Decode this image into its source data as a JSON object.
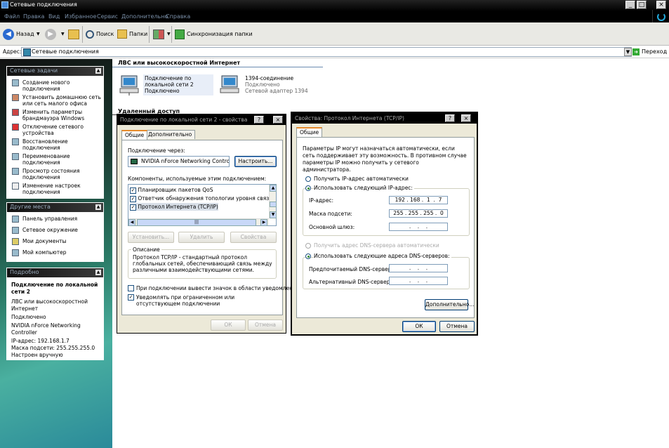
{
  "window": {
    "title": "Сетевые подключения"
  },
  "menu": [
    "Файл",
    "Правка",
    "Вид",
    "Избранное",
    "Сервис",
    "Дополнительно",
    "Справка"
  ],
  "toolbar": {
    "back": "Назад",
    "search": "Поиск",
    "folders": "Папки",
    "sync": "Синхронизация папки"
  },
  "address": {
    "label": "Адрес:",
    "value": "Сетевые подключения",
    "go": "Переход"
  },
  "left": {
    "network_tasks": {
      "title": "Сетевые задачи",
      "items": [
        "Создание нового подключения",
        "Установить домашнюю сеть или сеть малого офиса",
        "Изменить параметры брандмауэра Windows",
        "Отключение сетевого устройства",
        "Восстановление подключения",
        "Переименование подключения",
        "Просмотр состояния подключения",
        "Изменение настроек подключения"
      ]
    },
    "other_places": {
      "title": "Другие места",
      "items": [
        "Панель управления",
        "Сетевое окружение",
        "Мои документы",
        "Мой компьютер"
      ]
    },
    "details": {
      "title": "Подробно",
      "name": "Подключение по локальной сети 2",
      "lines": [
        "ЛВС или высокоскоростной Интернет",
        "Подключено",
        "NVIDIA nForce Networking Controller",
        "IP-адрес: 192.168.1.7",
        "Маска подсети: 255.255.255.0",
        "Настроен вручную"
      ]
    }
  },
  "content": {
    "group_lan": "ЛВС или высокоскоростной Интернет",
    "conn1": {
      "name": "Подключение по локальной сети 2",
      "status": "Подключено"
    },
    "conn2": {
      "name": "1394-соединение",
      "status": "Подключено",
      "device": "Сетевой адаптер 1394"
    },
    "group_remote": "Удаленный доступ"
  },
  "props": {
    "title": "Подключение по локальной сети 2 - свойства",
    "tabs": [
      "Общие",
      "Дополнительно"
    ],
    "connect_using": "Подключение через:",
    "adapter": "NVIDIA nForce Networking Controller",
    "configure": "Настроить...",
    "components_label": "Компоненты, используемые этим подключением:",
    "components": [
      "Планировщик пакетов QoS",
      "Ответчик обнаружения топологии уровня связи",
      "Протокол Интернета (TCP/IP)"
    ],
    "install": "Установить...",
    "remove": "Удалить",
    "properties": "Свойства",
    "desc_title": "Описание",
    "desc": "Протокол TCP/IP - стандартный протокол глобальных сетей, обеспечивающий связь между различными взаимодействующими сетями.",
    "show_icon": "При подключении вывести значок в области уведомлений",
    "notify": "Уведомлять при ограниченном или отсутствующем подключении",
    "ok": "ОК",
    "cancel": "Отмена"
  },
  "tcpip": {
    "title": "Свойства: Протокол Интернета (TCP/IP)",
    "tab": "Общие",
    "intro": "Параметры IP могут назначаться автоматически, если сеть поддерживает эту возможность. В противном случае параметры IP можно получить у сетевого администратора.",
    "auto_ip": "Получить IP-адрес автоматически",
    "use_ip": "Использовать следующий IP-адрес:",
    "ip_label": "IP-адрес:",
    "ip_value": "192 . 168 .  1  .  7",
    "mask_label": "Маска подсети:",
    "mask_value": "255 . 255 . 255 .  0",
    "gw_label": "Основной шлюз:",
    "gw_value": "  .    .    .  ",
    "auto_dns": "Получить адрес DNS-сервера автоматически",
    "use_dns": "Использовать следующие адреса DNS-серверов:",
    "dns1_label": "Предпочитаемый DNS-сервер:",
    "dns1_value": "  .    .    .  ",
    "dns2_label": "Альтернативный DNS-сервер:",
    "dns2_value": "  .    .    .  ",
    "advanced": "Дополнительно...",
    "ok": "ОК",
    "cancel": "Отмена"
  }
}
